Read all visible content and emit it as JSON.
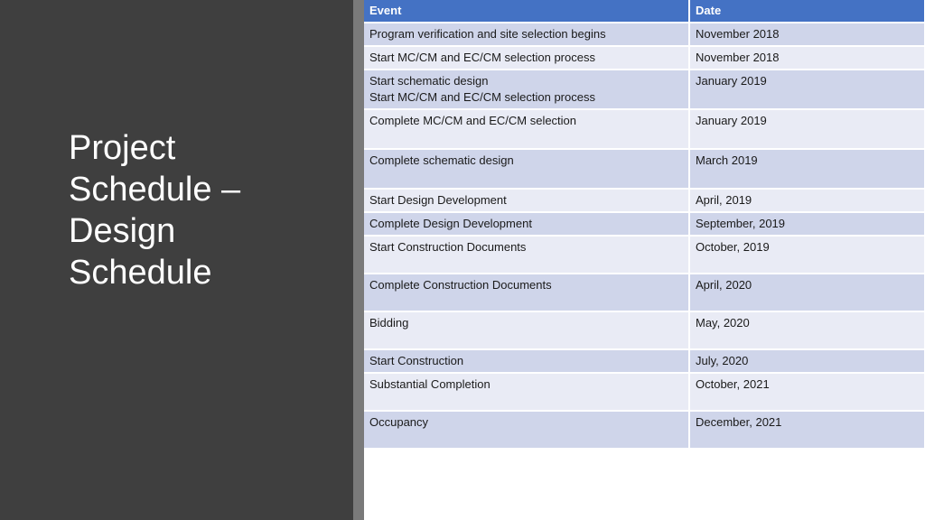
{
  "slide": {
    "title_lines": [
      "Project",
      "Schedule –",
      "Design",
      "Schedule"
    ]
  },
  "colors": {
    "left_panel": "#3f3f3f",
    "header_fill": "#4472c4",
    "row_dark": "#cfd5ea",
    "row_light": "#e9ebf5"
  },
  "table": {
    "headers": {
      "event": "Event",
      "date": "Date"
    },
    "rows": [
      {
        "event": [
          "Program verification and site selection begins"
        ],
        "date": "November 2018"
      },
      {
        "event": [
          "Start MC/CM and EC/CM selection process"
        ],
        "date": "November 2018"
      },
      {
        "event": [
          "Start schematic design",
          "Start MC/CM and EC/CM selection process"
        ],
        "date": "January 2019"
      },
      {
        "event": [
          "Complete MC/CM and EC/CM selection"
        ],
        "date": "January 2019"
      },
      {
        "event": [
          "Complete schematic design"
        ],
        "date": "March 2019"
      },
      {
        "event": [
          "Start Design Development"
        ],
        "date": "April, 2019"
      },
      {
        "event": [
          "Complete Design Development"
        ],
        "date": "September, 2019"
      },
      {
        "event": [
          "Start Construction Documents"
        ],
        "date": "October, 2019"
      },
      {
        "event": [
          "Complete Construction Documents"
        ],
        "date": "April, 2020"
      },
      {
        "event": [
          "Bidding"
        ],
        "date": "May, 2020"
      },
      {
        "event": [
          "Start Construction"
        ],
        "date": "July, 2020"
      },
      {
        "event": [
          "Substantial Completion"
        ],
        "date": "October, 2021"
      },
      {
        "event": [
          "Occupancy"
        ],
        "date": "December, 2021"
      }
    ]
  }
}
